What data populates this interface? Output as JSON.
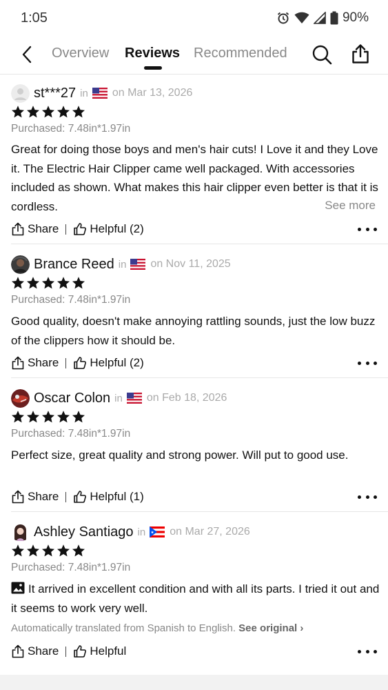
{
  "status_bar": {
    "time": "1:05",
    "battery": "90%"
  },
  "header": {
    "tabs": [
      {
        "label": "Overview",
        "active": false
      },
      {
        "label": "Reviews",
        "active": true
      },
      {
        "label": "Recommended",
        "active": false
      }
    ]
  },
  "reviews": [
    {
      "username": "st***27",
      "in": "in",
      "country_flag": "us-flag",
      "date": "on Mar 13, 2026",
      "rating": 5,
      "purchased": "Purchased: 7.48in*1.97in",
      "text": "Great for doing those boys and men's hair cuts! I Love it and they Love it. The Electric Hair Clipper came well packaged. With accessories included as shown. What makes this hair clipper even better is that it is cordless.",
      "see_more": "See more",
      "share_label": "Share",
      "helpful_label": "Helpful (2)"
    },
    {
      "username": "Brance Reed",
      "in": "in",
      "country_flag": "us-flag",
      "date": "on Nov 11, 2025",
      "rating": 5,
      "purchased": "Purchased: 7.48in*1.97in",
      "text": "Good quality, doesn't make annoying rattling sounds, just the low buzz of the clippers how it should be.",
      "share_label": "Share",
      "helpful_label": "Helpful (2)"
    },
    {
      "username": "Oscar Colon",
      "in": "in",
      "country_flag": "us-flag",
      "date": "on Feb 18, 2026",
      "rating": 5,
      "purchased": "Purchased: 7.48in*1.97in",
      "text": "Perfect size, great quality and strong power. Will put to good use.",
      "share_label": "Share",
      "helpful_label": "Helpful (1)"
    },
    {
      "username": "Ashley Santiago",
      "in": "in",
      "country_flag": "puerto-rico-flag",
      "date": "on Mar 27, 2026",
      "rating": 5,
      "purchased": "Purchased: 7.48in*1.97in",
      "text": "It arrived in excellent condition and with all its parts. I tried it out and it seems to work very well.",
      "translated_note": "Automatically translated from Spanish to English.",
      "see_original": "See original",
      "share_label": "Share",
      "helpful_label": "Helpful"
    }
  ]
}
